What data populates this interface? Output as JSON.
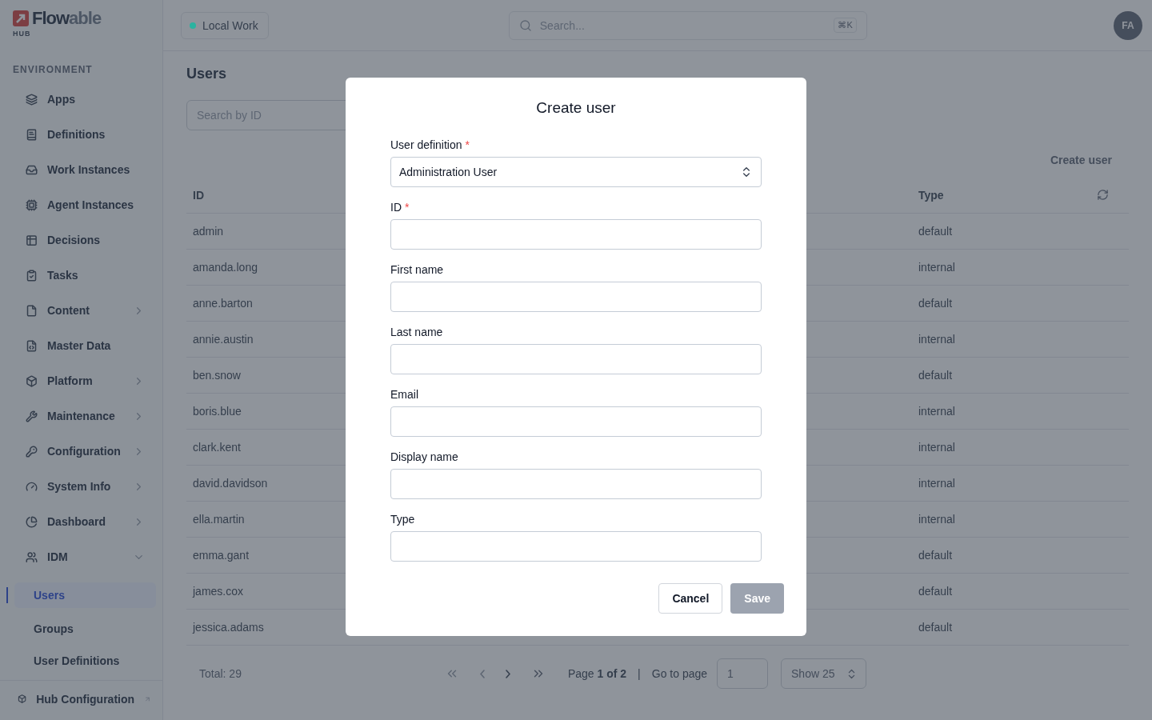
{
  "brand": {
    "name_dark": "Flow",
    "name_light": "able",
    "sub": "HUB"
  },
  "sidebar": {
    "section": "ENVIRONMENT",
    "items": [
      {
        "label": "Apps",
        "kind": "link"
      },
      {
        "label": "Definitions",
        "kind": "link"
      },
      {
        "label": "Work Instances",
        "kind": "link"
      },
      {
        "label": "Agent Instances",
        "kind": "link"
      },
      {
        "label": "Decisions",
        "kind": "link"
      },
      {
        "label": "Tasks",
        "kind": "link"
      },
      {
        "label": "Content",
        "kind": "group",
        "expanded": false
      },
      {
        "label": "Master Data",
        "kind": "link"
      },
      {
        "label": "Platform",
        "kind": "group",
        "expanded": false
      },
      {
        "label": "Maintenance",
        "kind": "group",
        "expanded": false
      },
      {
        "label": "Configuration",
        "kind": "group",
        "expanded": false
      },
      {
        "label": "System Info",
        "kind": "group",
        "expanded": false
      },
      {
        "label": "Dashboard",
        "kind": "group",
        "expanded": false
      },
      {
        "label": "IDM",
        "kind": "group",
        "expanded": true,
        "children": [
          {
            "label": "Users",
            "selected": true
          },
          {
            "label": "Groups",
            "selected": false
          },
          {
            "label": "User Definitions",
            "selected": false
          }
        ]
      }
    ],
    "footer": {
      "label": "Hub Configuration"
    }
  },
  "header": {
    "environment": {
      "label": "Local Work",
      "color": "#2bb3a0"
    },
    "search": {
      "placeholder": "Search...",
      "shortcut": "⌘K"
    },
    "avatar": "FA"
  },
  "page": {
    "title": "Users",
    "search": {
      "placeholder": "Search by ID"
    },
    "create_button": "Create user",
    "table": {
      "columns": [
        "ID",
        "Type"
      ],
      "rows": [
        [
          "admin",
          "default"
        ],
        [
          "amanda.long",
          "internal"
        ],
        [
          "anne.barton",
          "default"
        ],
        [
          "annie.austin",
          "internal"
        ],
        [
          "ben.snow",
          "default"
        ],
        [
          "boris.blue",
          "internal"
        ],
        [
          "clark.kent",
          "internal"
        ],
        [
          "david.davidson",
          "internal"
        ],
        [
          "ella.martin",
          "internal"
        ],
        [
          "emma.gant",
          "default"
        ],
        [
          "james.cox",
          "default"
        ],
        [
          "jessica.adams",
          "default"
        ]
      ]
    },
    "footer": {
      "total": "Total: 29",
      "page": "Page **1 of 2**",
      "separator": "|",
      "goto_label": "Go to page",
      "goto_value": "1",
      "page_size": "Show 25"
    }
  },
  "dialog": {
    "title": "Create user",
    "fields": [
      {
        "label": "User definition",
        "required_mark": "*",
        "kind": "select",
        "value": "Administration User"
      },
      {
        "label": "ID",
        "required_mark": "*",
        "kind": "text"
      },
      {
        "label": "First name",
        "kind": "text"
      },
      {
        "label": "Last name",
        "kind": "text"
      },
      {
        "label": "Email",
        "kind": "text"
      },
      {
        "label": "Display name",
        "kind": "text"
      },
      {
        "label": "Type",
        "kind": "text"
      }
    ],
    "buttons": [
      {
        "label": "Cancel",
        "kind": "secondary",
        "disabled": false
      },
      {
        "label": "Save",
        "kind": "primary",
        "disabled": true
      }
    ]
  }
}
